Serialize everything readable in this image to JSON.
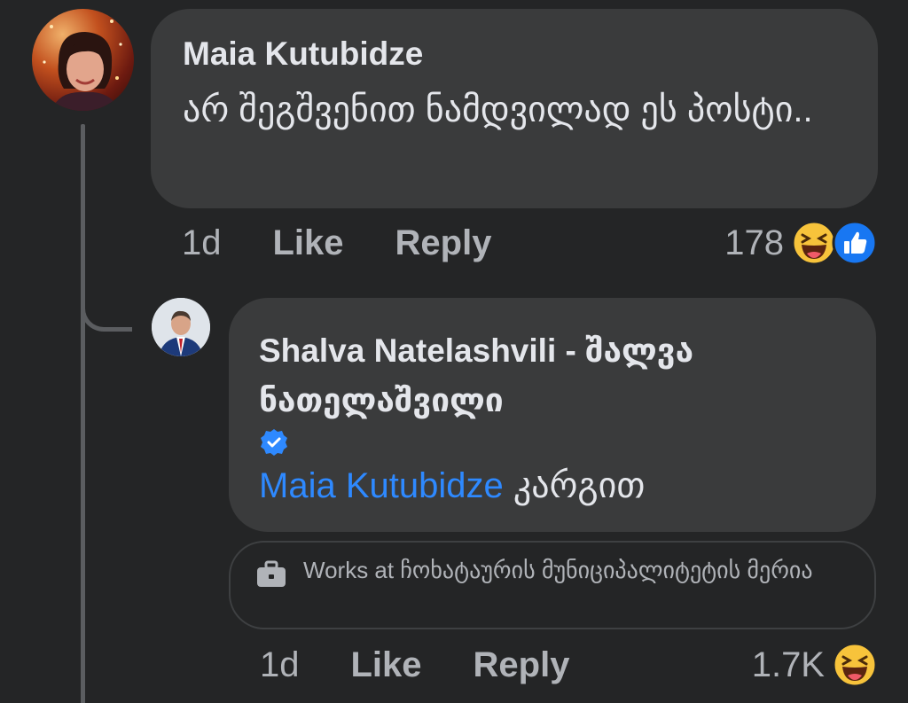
{
  "comment": {
    "author": "Maia Kutubidze",
    "text": "არ შეგშვენით ნამდვილად ეს პოსტი..",
    "time": "1d",
    "like_label": "Like",
    "reply_label": "Reply",
    "reaction_count": "178",
    "reactions": [
      "laughing-emoji-icon",
      "like-thumb-icon"
    ]
  },
  "reply": {
    "author": "Shalva Natelashvili -  შალვა ნათელაშვილი",
    "verified": true,
    "mention": "Maia Kutubidze",
    "text": "კარგით",
    "time": "1d",
    "like_label": "Like",
    "reply_label": "Reply",
    "reaction_count": "1.7K",
    "reactions": [
      "laughing-emoji-icon"
    ],
    "works_at": "Works at ჩოხატაურის მუნიციპალიტეტის მერია"
  },
  "colors": {
    "background": "#242526",
    "bubble": "#3a3b3c",
    "mention": "#2e89ff",
    "muted_text": "#b0b3b8",
    "verified": "#2e89ff",
    "like_blue": "#1877f2",
    "laugh_yellow": "#f7c33b"
  }
}
